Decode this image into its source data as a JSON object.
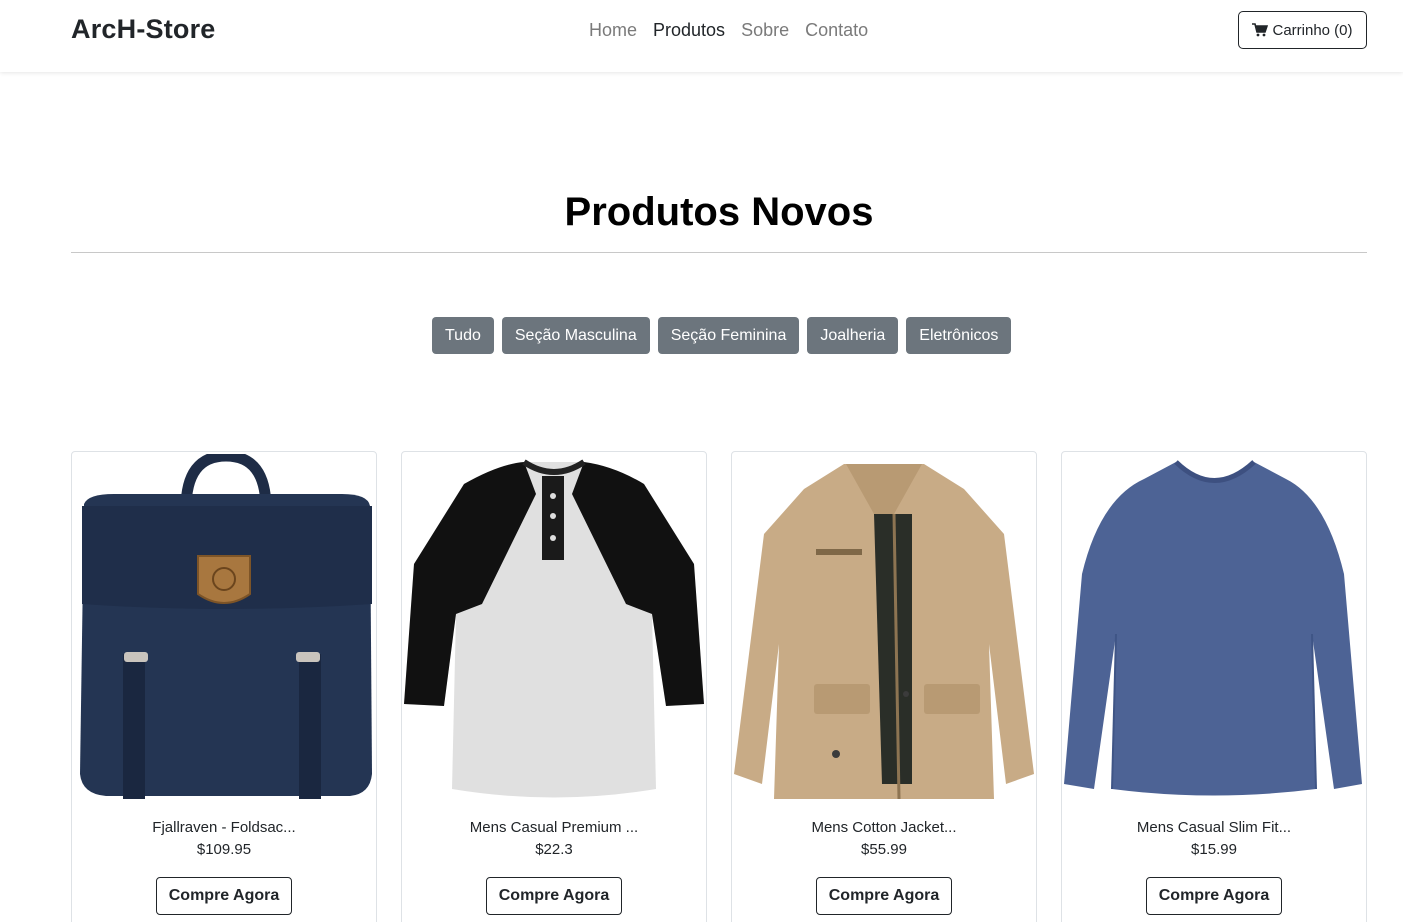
{
  "brand": "ArcH-Store",
  "nav": {
    "items": [
      "Home",
      "Produtos",
      "Sobre",
      "Contato"
    ],
    "active": "Produtos"
  },
  "cart": {
    "label": "Carrinho (0)"
  },
  "main": {
    "title": "Produtos Novos",
    "filters": [
      "Tudo",
      "Seção Masculina",
      "Seção Feminina",
      "Joalheria",
      "Eletrônicos"
    ]
  },
  "products": [
    {
      "title": "Fjallraven - Foldsac...",
      "price": "$109.95",
      "button": "Compre Agora",
      "image": "backpack"
    },
    {
      "title": "Mens Casual Premium ...",
      "price": "$22.3",
      "button": "Compre Agora",
      "image": "raglan-tshirt"
    },
    {
      "title": "Mens Cotton Jacket...",
      "price": "$55.99",
      "button": "Compre Agora",
      "image": "cotton-jacket"
    },
    {
      "title": "Mens Casual Slim Fit...",
      "price": "$15.99",
      "button": "Compre Agora",
      "image": "slim-fit-shirt"
    }
  ],
  "colors": {
    "filter_bg": "#6c757d",
    "backpack": "#243553",
    "jacket": "#c8ab86",
    "slim_shirt": "#4d6395"
  }
}
